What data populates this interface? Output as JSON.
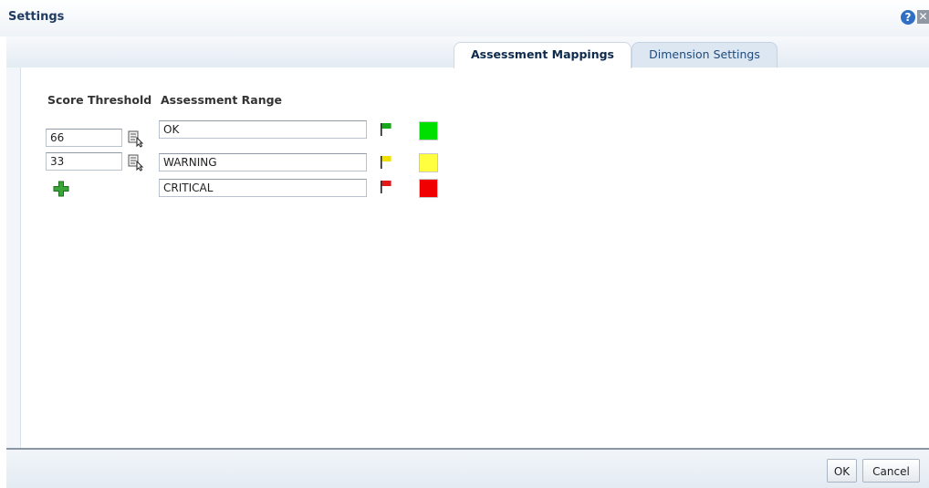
{
  "dialog": {
    "title": "Settings",
    "help_glyph": "?",
    "close_glyph": "✕"
  },
  "tabs": [
    {
      "label": "Assessment Mappings",
      "active": true
    },
    {
      "label": "Dimension Settings",
      "active": false
    }
  ],
  "table": {
    "score_header": "Score Threshold",
    "range_header": "Assessment Range",
    "thresholds": [
      "66",
      "33"
    ],
    "ranges": [
      {
        "label": "OK",
        "flag_icon": "green-flag-icon",
        "color": "#00e000"
      },
      {
        "label": "WARNING",
        "flag_icon": "yellow-flag-icon",
        "color": "#ffff40"
      },
      {
        "label": "CRITICAL",
        "flag_icon": "red-flag-icon",
        "color": "#f00000"
      }
    ]
  },
  "footer": {
    "ok_label": "OK",
    "cancel_label": "Cancel"
  }
}
